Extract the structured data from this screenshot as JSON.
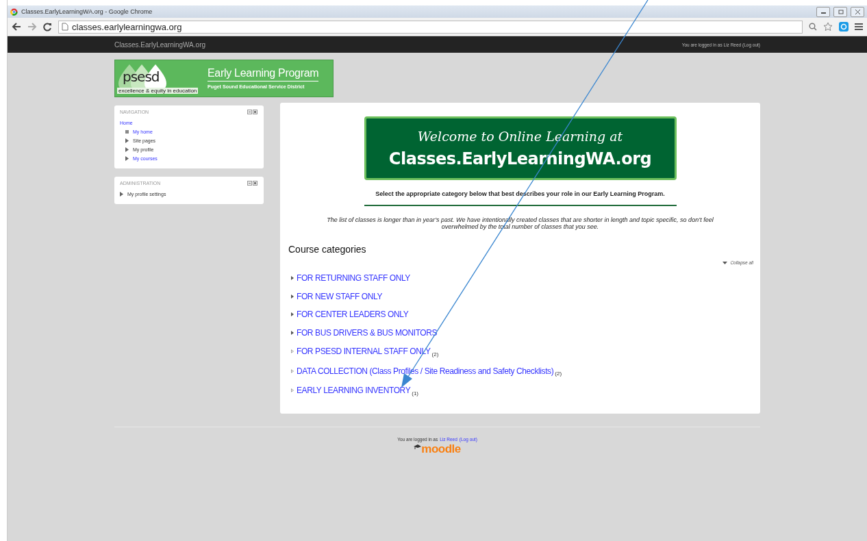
{
  "browser": {
    "title": "Classes.EarlyLearningWA.org - Google Chrome",
    "url": "classes.earlylearningwa.org"
  },
  "topbar": {
    "site_name": "Classes.EarlyLearningWA.org",
    "login_text": "You are logged in as Liz Reed (Log out)"
  },
  "logo": {
    "mark": "psesd",
    "tagline": "excellence & equity in education",
    "title": "Early Learning Program",
    "subtitle": "Puget Sound Educational Service District"
  },
  "blocks": [
    {
      "title": "NAVIGATION",
      "items": [
        {
          "label": "Home",
          "link": true,
          "kind": "root",
          "children": [
            {
              "label": "My home",
              "link": true,
              "kind": "leaf"
            },
            {
              "label": "Site pages",
              "link": false,
              "kind": "branch"
            },
            {
              "label": "My profile",
              "link": false,
              "kind": "branch"
            },
            {
              "label": "My courses",
              "link": true,
              "kind": "branch"
            }
          ]
        }
      ]
    },
    {
      "title": "ADMINISTRATION",
      "items": [
        {
          "label": "My profile settings",
          "link": false,
          "kind": "branch"
        }
      ]
    }
  ],
  "banner": {
    "line1": "Welcome to Online Learning at",
    "line2": "Classes.EarlyLearningWA.org"
  },
  "instruction": "Select the appropriate category below that best describes your role in our Early Learning Program.",
  "note": "The list of classes is longer than in year’s past. We have intentionally created classes that are shorter in length and topic specific, so don’t feel overwhelmed by the total number of classes that you see.",
  "categories_heading": "Course categories",
  "collapse_all": "Collapse all",
  "categories": [
    {
      "label": "FOR RETURNING STAFF ONLY",
      "expandable": true
    },
    {
      "label": "FOR NEW STAFF ONLY",
      "expandable": true
    },
    {
      "label": "FOR CENTER LEADERS ONLY",
      "expandable": true
    },
    {
      "label": "FOR BUS DRIVERS & BUS MONITORS",
      "expandable": true
    },
    {
      "label": "FOR PSESD INTERNAL STAFF ONLY",
      "expandable": false,
      "count": "(2)"
    },
    {
      "label": "DATA COLLECTION (Class Profiles / Site Readiness and Safety Checklists)",
      "expandable": false,
      "count": "(2)"
    },
    {
      "label": "EARLY LEARNING INVENTORY",
      "expandable": false,
      "count": "(1)"
    }
  ],
  "footer": {
    "text": "You are logged in as",
    "user": "Liz Reed",
    "logout": "(Log out)",
    "logo": "moodle"
  }
}
